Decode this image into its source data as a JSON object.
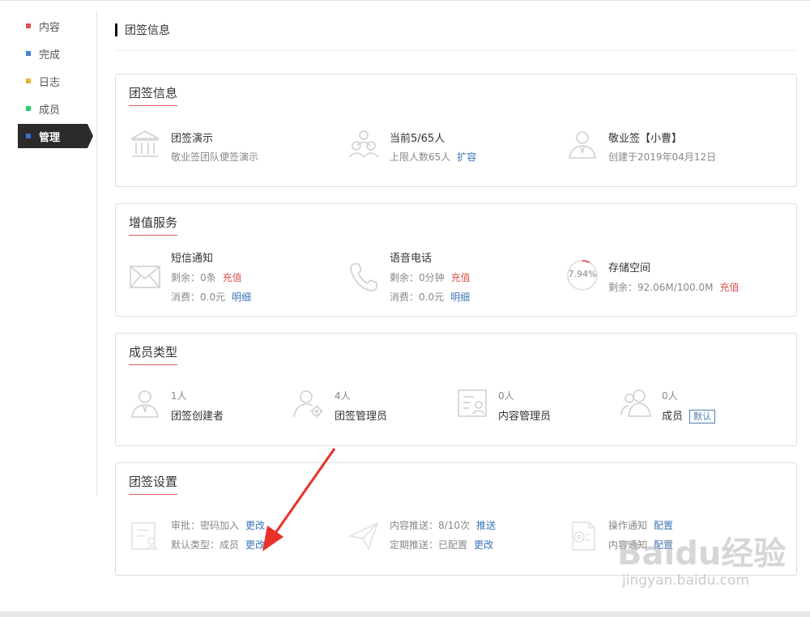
{
  "sidebar": {
    "items": [
      {
        "label": "内容",
        "color": "#d9534f"
      },
      {
        "label": "完成",
        "color": "#4a7fd6"
      },
      {
        "label": "日志",
        "color": "#f0ad2e"
      },
      {
        "label": "成员",
        "color": "#2ecc71"
      },
      {
        "label": "管理",
        "color": "#3b6fd8",
        "active": true
      }
    ]
  },
  "header": {
    "title": "团签信息"
  },
  "team_info": {
    "title": "团签信息",
    "name": {
      "main": "团签演示",
      "sub": "敬业签团队便签演示"
    },
    "members": {
      "main": "当前5/65人",
      "sub": "上限人数65人",
      "action": "扩容"
    },
    "creator": {
      "main": "敬业签【小曹】",
      "sub": "创建于2019年04月12日"
    }
  },
  "value_services": {
    "title": "增值服务",
    "sms": {
      "main": "短信通知",
      "remain": "剩余：0条",
      "recharge": "充值",
      "cost": "消费：0.0元",
      "detail": "明细"
    },
    "voice": {
      "main": "语音电话",
      "remain": "剩余：0分钟",
      "recharge": "充值",
      "cost": "消费：0.0元",
      "detail": "明细"
    },
    "storage": {
      "main": "存储空间",
      "percent_text": "7.94%",
      "percent": 7.94,
      "remain": "剩余：92.06M/100.0M",
      "recharge": "充值"
    }
  },
  "member_types": {
    "title": "成员类型",
    "creator": {
      "count": "1人",
      "label": "团签创建者"
    },
    "admin": {
      "count": "4人",
      "label": "团签管理员"
    },
    "content_admin": {
      "count": "0人",
      "label": "内容管理员"
    },
    "member": {
      "count": "0人",
      "label": "成员",
      "badge": "默认"
    }
  },
  "settings": {
    "title": "团签设置",
    "approval": {
      "text": "审批：密码加入",
      "action": "更改"
    },
    "default_type": {
      "text": "默认类型：成员",
      "action": "更改"
    },
    "push_content": {
      "text": "内容推送：8/10次",
      "action": "推送"
    },
    "push_schedule": {
      "text": "定期推送：已配置",
      "action": "更改"
    },
    "op_notice": {
      "text": "操作通知",
      "action": "配置"
    },
    "content_notice": {
      "text": "内容通知",
      "action": "配置"
    }
  },
  "watermark": {
    "logo": "Baidu经验",
    "url": "jingyan.baidu.com"
  },
  "colors": {
    "accent_red": "#e05b5b",
    "link_blue": "#3a74b8",
    "arrow_red": "#e8302c"
  }
}
